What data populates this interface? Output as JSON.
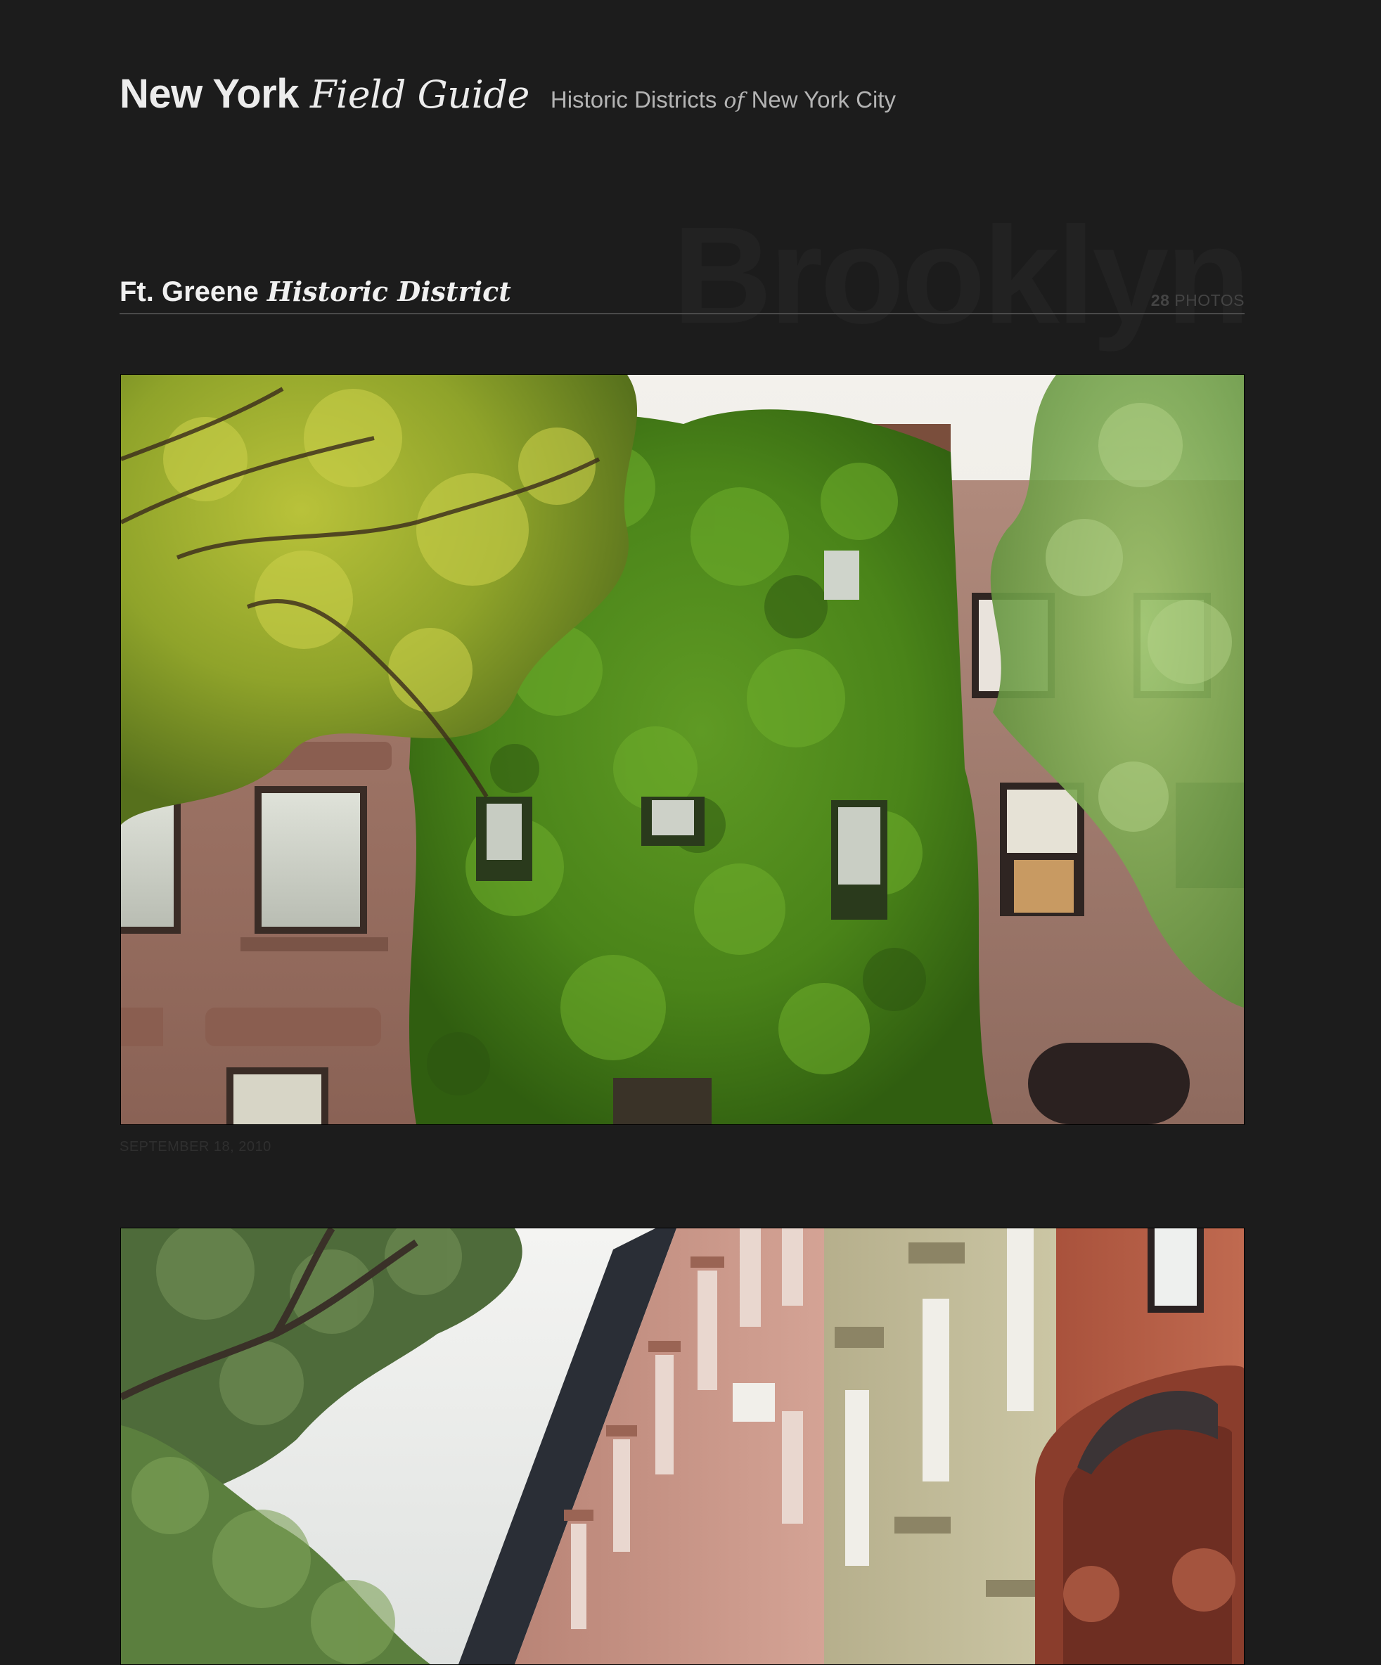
{
  "header": {
    "brand_strong": "New York",
    "brand_italic": "Field Guide",
    "tagline_before": "Historic Districts",
    "tagline_of": "of",
    "tagline_after": "New York City"
  },
  "section": {
    "borough": "Brooklyn",
    "district_name": "Ft. Greene",
    "district_suffix": "Historic District",
    "photo_count": "28",
    "photo_count_label": "PHOTOS"
  },
  "photos": [
    {
      "subject": "ivy-covered brownstone row houses",
      "date": "SEPTEMBER 18, 2010"
    },
    {
      "subject": "row of brownstones with ornate cornices"
    }
  ],
  "colors": {
    "background": "#1c1c1c",
    "header_text": "#ececec",
    "tagline_text": "#b4b4b4",
    "watermark_text": "#222222",
    "rule": "#4a4a4a"
  }
}
